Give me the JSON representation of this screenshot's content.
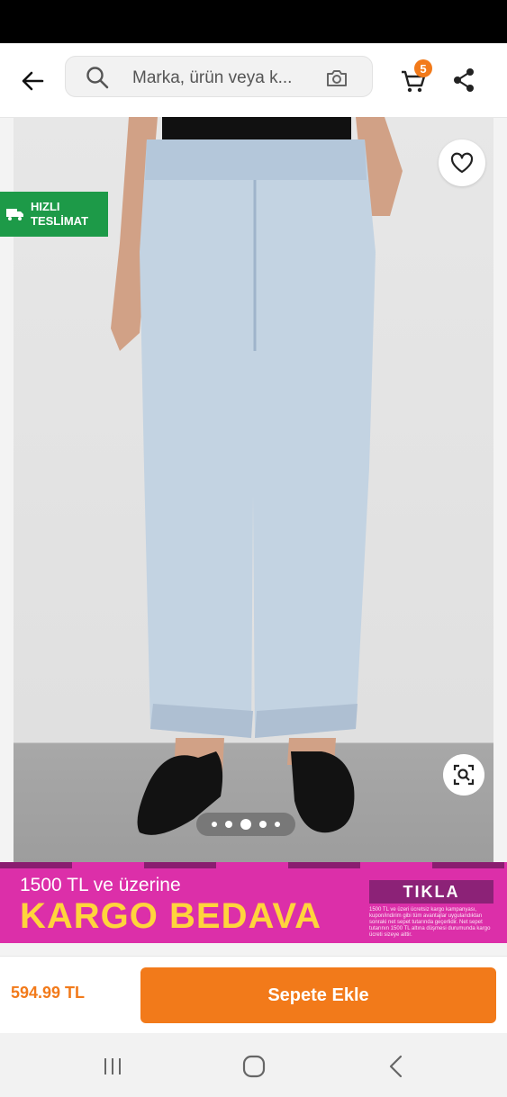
{
  "header": {
    "search_placeholder": "Marka, ürün veya k...",
    "cart_count": "5",
    "icons": [
      "back-arrow-icon",
      "search-icon",
      "camera-search-icon",
      "cart-icon",
      "share-icon"
    ]
  },
  "product": {
    "badge_label": "HIZLI TESLİMAT",
    "image_count": 5,
    "active_image_index": 3,
    "icons": [
      "heart-icon",
      "truck-icon",
      "visual-search-icon"
    ]
  },
  "promo": {
    "line1": "1500 TL ve üzerine",
    "line2": "KARGO BEDAVA",
    "cta": "TIKLA",
    "fine_print": "1500 TL ve üzeri ücretsiz kargo kampanyası, kupon/indirim gibi tüm avantajlar uygulandıktan sonraki net sepet tutarında geçerlidir. Net sepet tutarının 1500 TL altına düşmesi durumunda kargo ücreti sizeye aittir."
  },
  "footer": {
    "price": "594.99 TL",
    "add_to_cart": "Sepete Ekle"
  },
  "colors": {
    "brand_orange": "#f27a1a",
    "badge_green": "#1d9a48",
    "promo_magenta": "#dc2fa9",
    "promo_yellow": "#ffd43c"
  },
  "system_nav": [
    "recent-apps-icon",
    "home-icon",
    "back-icon"
  ]
}
